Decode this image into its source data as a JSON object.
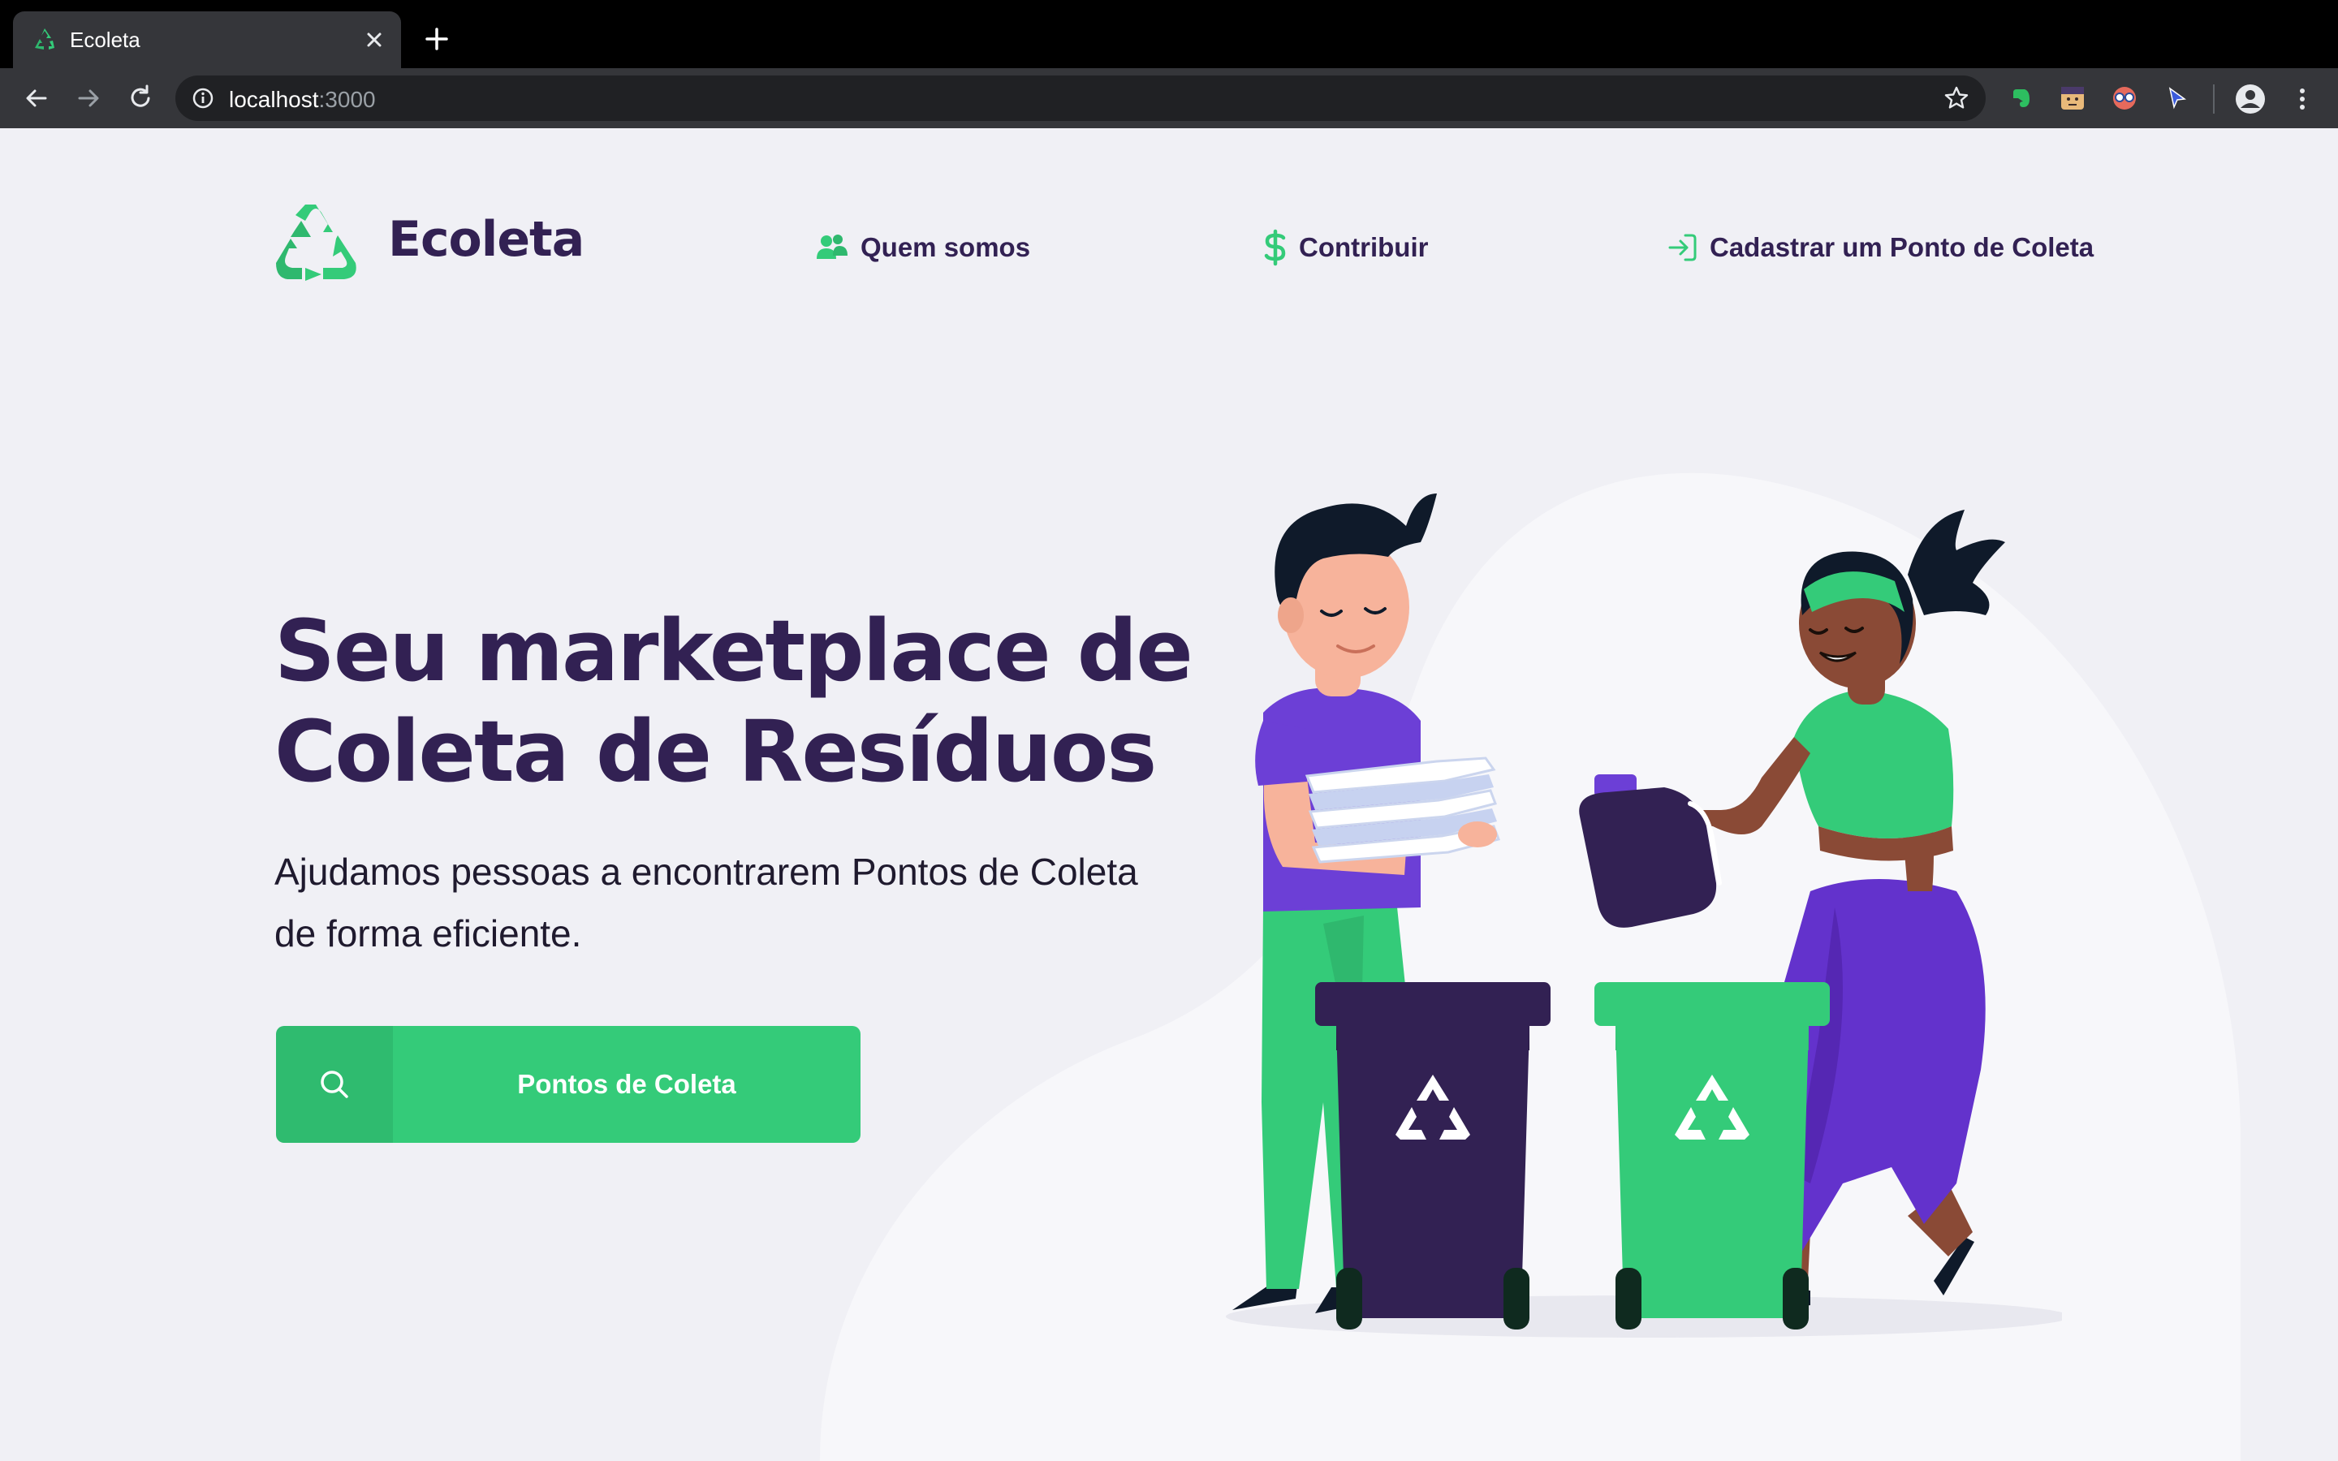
{
  "browser": {
    "tab_title": "Ecoleta",
    "url_host": "localhost",
    "url_port": ":3000"
  },
  "header": {
    "logo_text": "Ecoleta",
    "nav": [
      {
        "label": "Quem somos",
        "icon": "users-icon"
      },
      {
        "label": "Contribuir",
        "icon": "dollar-icon"
      },
      {
        "label": "Cadastrar um Ponto de Coleta",
        "icon": "log-in-icon"
      }
    ]
  },
  "hero": {
    "title_line1": "Seu marketplace de",
    "title_line2": "Coleta de Resíduos",
    "subtitle_line1": "Ajudamos pessoas a encontrarem Pontos de Coleta",
    "subtitle_line2": "de forma eficiente.",
    "cta_label": "Pontos de Coleta",
    "cta_icon": "search-icon"
  },
  "colors": {
    "primary": "#34cb79",
    "title": "#322153",
    "background": "#f0f0f5"
  }
}
